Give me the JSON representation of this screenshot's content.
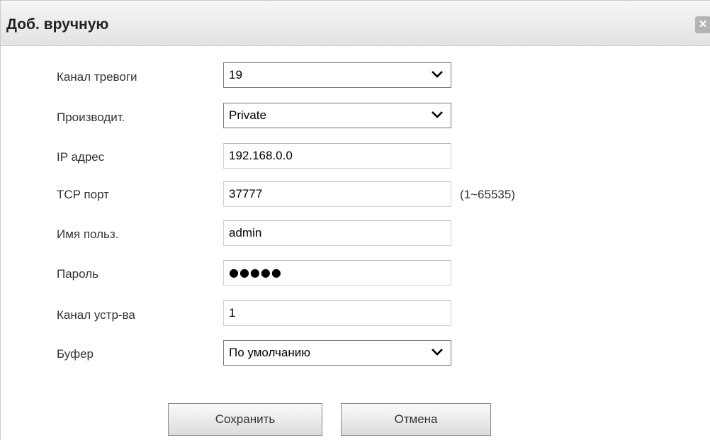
{
  "dialog": {
    "title": "Доб. вручную",
    "close_glyph": "×"
  },
  "form": {
    "alarm_channel": {
      "label": "Канал тревоги",
      "value": "19"
    },
    "manufacturer": {
      "label": "Производит.",
      "value": "Private"
    },
    "ip_address": {
      "label": "IP адрес",
      "value": "192.168.0.0"
    },
    "tcp_port": {
      "label": "TCP порт",
      "value": "37777",
      "hint": "(1~65535)"
    },
    "username": {
      "label": "Имя польз.",
      "value": "admin"
    },
    "password": {
      "label": "Пароль",
      "value": "●●●●●"
    },
    "device_channel": {
      "label": "Канал устр-ва",
      "value": "1"
    },
    "buffer": {
      "label": "Буфер",
      "value": "По умолчанию"
    }
  },
  "buttons": {
    "save": "Сохранить",
    "cancel": "Отмена"
  },
  "icons": {
    "close": "close-icon",
    "dropdown": "chevron-down-icon"
  }
}
